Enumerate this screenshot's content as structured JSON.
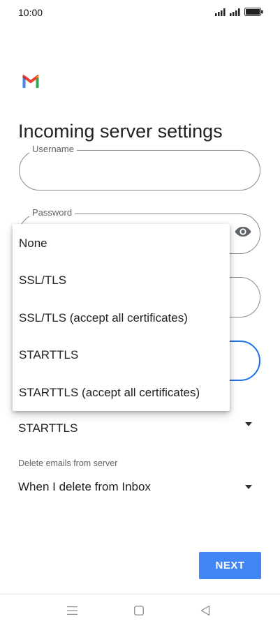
{
  "status_bar": {
    "time": "10:00"
  },
  "page": {
    "title": "Incoming server settings"
  },
  "fields": {
    "username_label": "Username",
    "password_label": "Password"
  },
  "security": {
    "value": "STARTTLS"
  },
  "delete_emails": {
    "label": "Delete emails from server",
    "value": "When I delete from Inbox"
  },
  "buttons": {
    "next_label": "NEXT"
  },
  "security_menu": {
    "options": [
      "None",
      "SSL/TLS",
      "SSL/TLS (accept all certificates)",
      "STARTTLS",
      "STARTTLS (accept all certificates)"
    ]
  },
  "colors": {
    "accent": "#4285f4",
    "focus_border": "#1a73e8",
    "gmail_red": "#ea4335",
    "gmail_blue": "#4285f4",
    "gmail_green": "#34a853",
    "gmail_yellow": "#fbbc04"
  },
  "icons": {
    "logo": "gmail-logo-icon",
    "password_toggle": "eye-icon",
    "nav_menu": "menu-lines-icon",
    "nav_home": "square-home-icon",
    "nav_back": "triangle-back-icon"
  }
}
